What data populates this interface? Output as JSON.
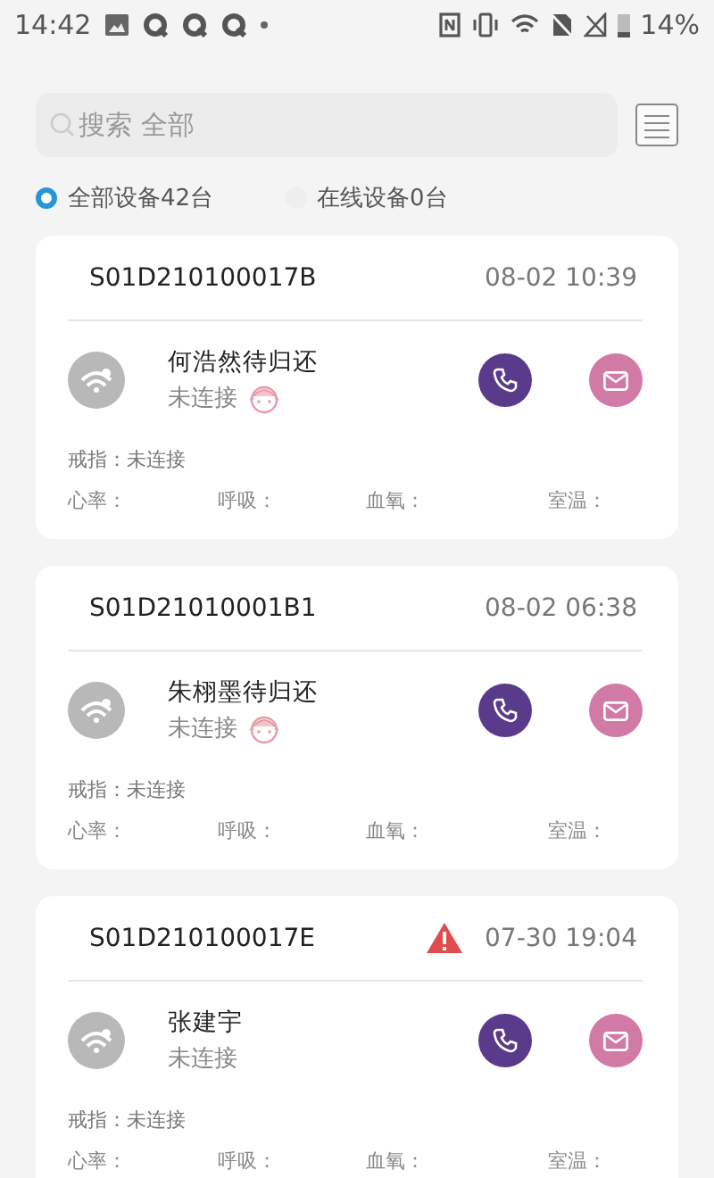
{
  "status_bar": {
    "time": "14:42",
    "battery": "14%"
  },
  "search": {
    "placeholder": "搜索 全部"
  },
  "filters": [
    {
      "label": "全部设备42台",
      "selected": true
    },
    {
      "label": "在线设备0台",
      "selected": false
    }
  ],
  "devices": [
    {
      "device_id": "S01D210100017B",
      "time": "08-02 10:39",
      "alert": false,
      "name": "何浩然待归还",
      "status": "未连接",
      "baby": true,
      "ring": "戒指：未连接",
      "vitals": [
        "心率：",
        "呼吸：",
        "血氧：",
        "室温："
      ]
    },
    {
      "device_id": "S01D21010001B1",
      "time": "08-02 06:38",
      "alert": false,
      "name": "朱栩墨待归还",
      "status": "未连接",
      "baby": true,
      "ring": "戒指：未连接",
      "vitals": [
        "心率：",
        "呼吸：",
        "血氧：",
        "室温："
      ]
    },
    {
      "device_id": "S01D210100017E",
      "time": "07-30 19:04",
      "alert": true,
      "name": "张建宇",
      "status": "未连接",
      "baby": false,
      "ring": "戒指：未连接",
      "vitals": [
        "心率：",
        "呼吸：",
        "血氧：",
        "室温："
      ]
    }
  ]
}
